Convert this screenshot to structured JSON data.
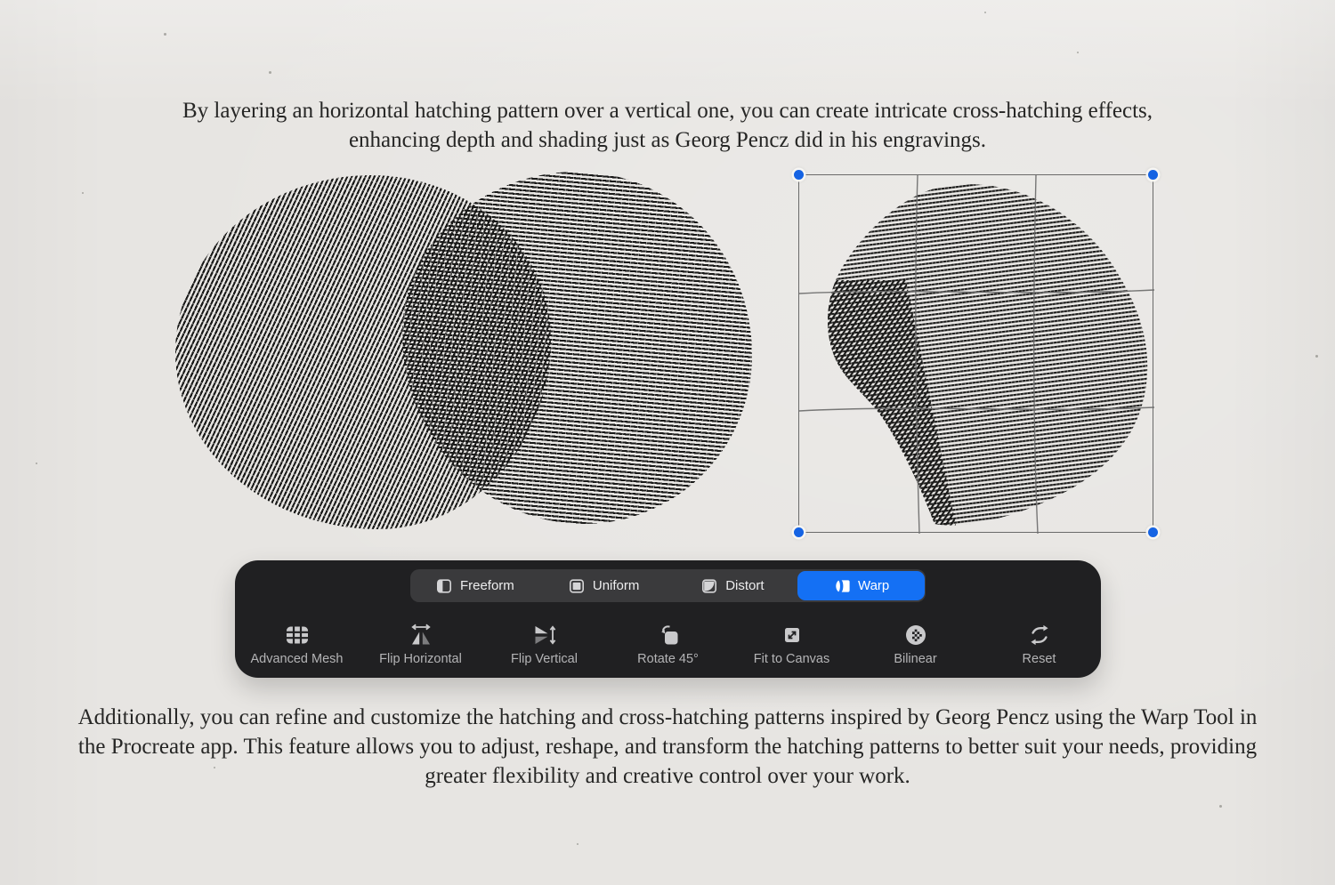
{
  "page": {
    "background_color": "#e7e5e2",
    "ink_color": "#191918"
  },
  "header": {
    "text": "By layering an horizontal hatching pattern over a vertical one, you can create intricate cross-hatching effects, enhancing depth and shading just as Georg Pencz did in his engravings."
  },
  "footer": {
    "text": "Additionally, you can refine and customize the hatching and cross-hatching patterns inspired by Georg Pencz using the Warp Tool in the Procreate app. This feature allows you to adjust, reshape, and transform the hatching patterns to better suit your needs, providing greater flexibility and creative control over your work."
  },
  "toolbar": {
    "background_color": "#202022",
    "segment_background_color": "#3a3a3c",
    "accent_color": "#1470f4",
    "tabs": [
      {
        "label": "Freeform",
        "icon": "freeform-icon",
        "selected": false
      },
      {
        "label": "Uniform",
        "icon": "uniform-icon",
        "selected": false
      },
      {
        "label": "Distort",
        "icon": "distort-icon",
        "selected": false
      },
      {
        "label": "Warp",
        "icon": "warp-icon",
        "selected": true
      }
    ],
    "buttons": [
      {
        "label": "Advanced Mesh",
        "icon": "advanced-mesh-icon"
      },
      {
        "label": "Flip Horizontal",
        "icon": "flip-horizontal-icon"
      },
      {
        "label": "Flip Vertical",
        "icon": "flip-vertical-icon"
      },
      {
        "label": "Rotate 45°",
        "icon": "rotate-45-icon"
      },
      {
        "label": "Fit to Canvas",
        "icon": "fit-to-canvas-icon"
      },
      {
        "label": "Bilinear",
        "icon": "bilinear-icon"
      },
      {
        "label": "Reset",
        "icon": "reset-icon"
      }
    ]
  },
  "transform_box": {
    "handle_color": "#1563e3",
    "grid_line_color": "#6d6d6d",
    "grid_rows": 3,
    "grid_cols": 3
  }
}
